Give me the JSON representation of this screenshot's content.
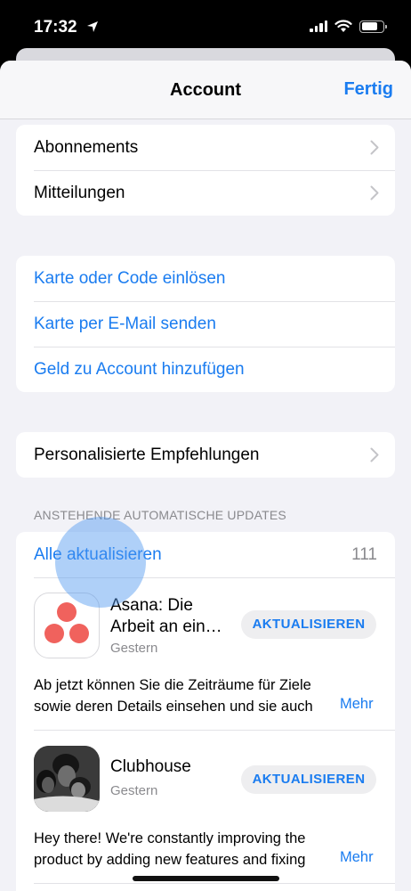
{
  "status": {
    "time": "17:32"
  },
  "nav": {
    "title": "Account",
    "done_label": "Fertig"
  },
  "group1": {
    "items": [
      {
        "label": "Abonnements"
      },
      {
        "label": "Mitteilungen"
      }
    ]
  },
  "group2": {
    "items": [
      {
        "label": "Karte oder Code einlösen"
      },
      {
        "label": "Karte per E-Mail senden"
      },
      {
        "label": "Geld zu Account hinzufügen"
      }
    ]
  },
  "group3": {
    "items": [
      {
        "label": "Personalisierte Empfehlungen"
      }
    ]
  },
  "updates": {
    "section_header": "ANSTEHENDE AUTOMATISCHE UPDATES",
    "update_all_label": "Alle aktualisieren",
    "count": "111",
    "apps": [
      {
        "name_line1": "Asana: Die",
        "name_line2": "Arbeit an ein…",
        "date": "Gestern",
        "button_label": "AKTUALISIEREN",
        "desc_line1": "Ab jetzt können Sie die Zeiträume für Ziele",
        "desc_line2": "sowie deren Details einsehen und sie auch",
        "more_label": "Mehr"
      },
      {
        "name_line1": "Clubhouse",
        "date": "Gestern",
        "button_label": "AKTUALISIEREN",
        "desc_line1": "Hey there! We're constantly improving the",
        "desc_line2": "product by adding new features and fixing",
        "more_label": "Mehr"
      }
    ]
  },
  "colors": {
    "accent": "#1a7cf0",
    "secondary_text": "#8a8a8e",
    "background": "#f2f2f7",
    "asana_red": "#f0625d"
  }
}
